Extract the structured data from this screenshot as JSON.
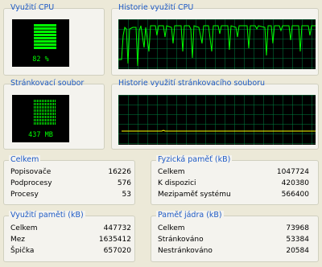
{
  "cpu_usage": {
    "title": "Využití CPU",
    "value_text": "82 %",
    "value": 82
  },
  "cpu_history": {
    "title": "Historie využití CPU"
  },
  "pagefile": {
    "title": "Stránkovací soubor",
    "value_text": "437 MB"
  },
  "pagefile_history": {
    "title": "Historie využití stránkovacího souboru"
  },
  "totals": {
    "title": "Celkem",
    "rows": [
      {
        "label": "Popisovače",
        "value": "16226"
      },
      {
        "label": "Podprocesy",
        "value": "576"
      },
      {
        "label": "Procesy",
        "value": "53"
      }
    ]
  },
  "physical_memory": {
    "title": "Fyzická paměť (kB)",
    "rows": [
      {
        "label": "Celkem",
        "value": "1047724"
      },
      {
        "label": "K dispozici",
        "value": "420380"
      },
      {
        "label": "Mezipaměť systému",
        "value": "566400"
      }
    ]
  },
  "commit_charge": {
    "title": "Využití paměti (kB)",
    "rows": [
      {
        "label": "Celkem",
        "value": "447732"
      },
      {
        "label": "Mez",
        "value": "1635412"
      },
      {
        "label": "Špička",
        "value": "657020"
      }
    ]
  },
  "kernel_memory": {
    "title": "Paměť jádra (kB)",
    "rows": [
      {
        "label": "Celkem",
        "value": "73968"
      },
      {
        "label": "Stránkováno",
        "value": "53384"
      },
      {
        "label": "Nestránkováno",
        "value": "20584"
      }
    ]
  },
  "colors": {
    "accent": "#1f5bc6",
    "graph_line": "#00ff00",
    "grid": "#008040",
    "page_line": "#ffff00"
  }
}
